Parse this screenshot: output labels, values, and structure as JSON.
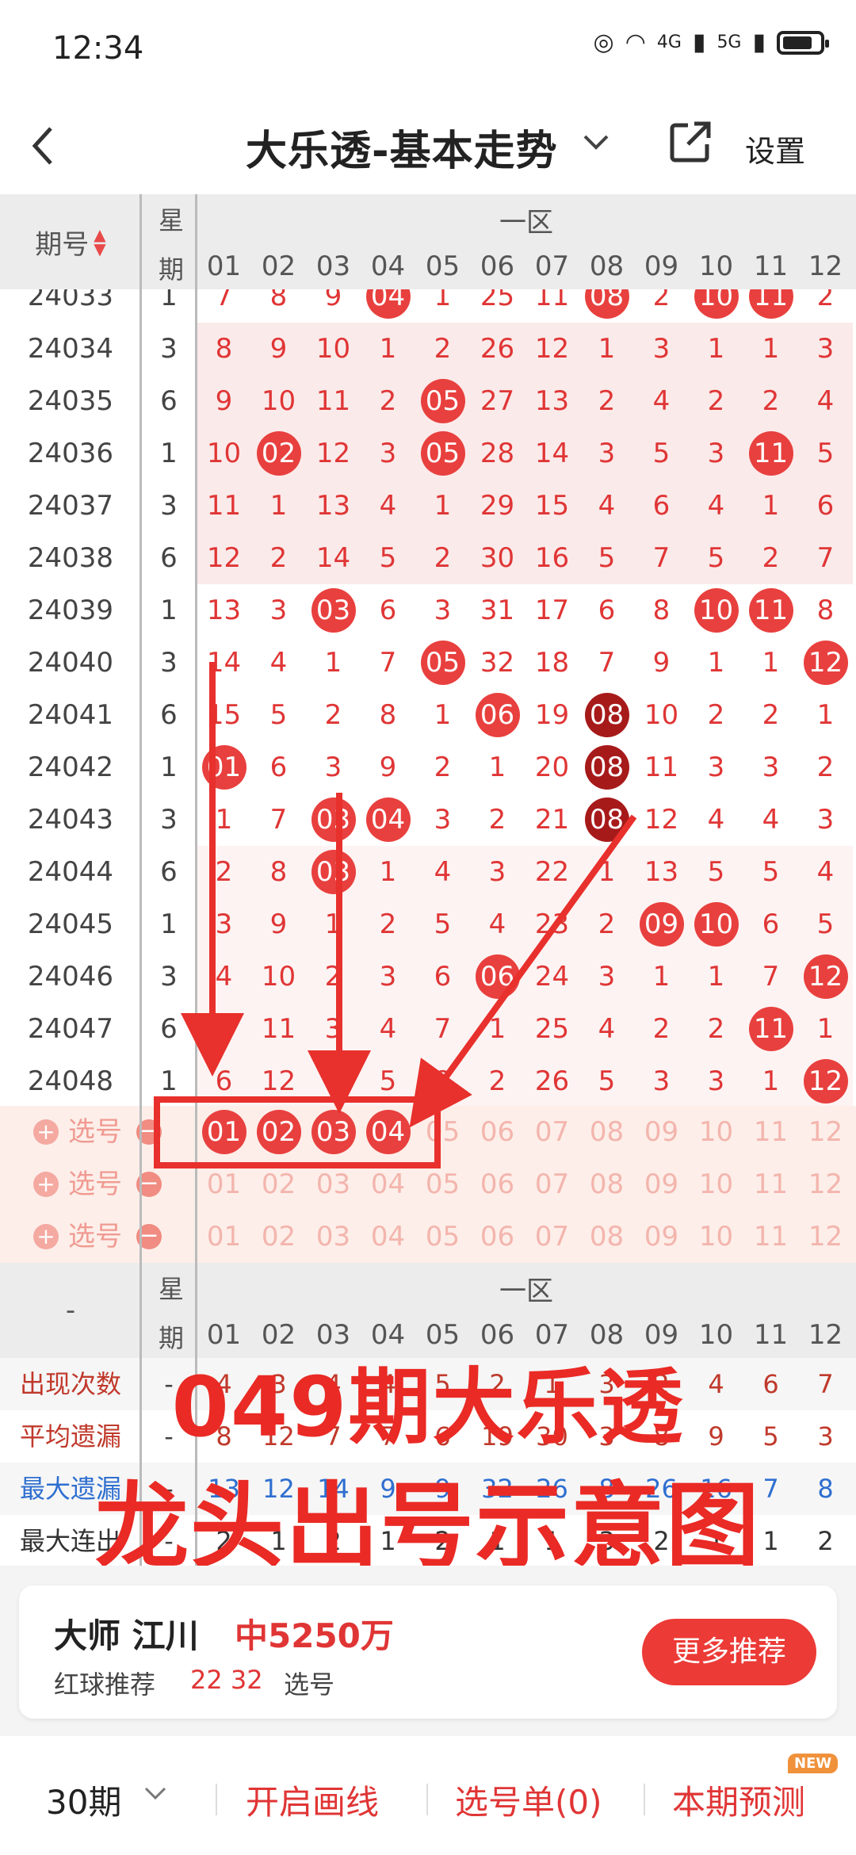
{
  "status": {
    "time": "12:34",
    "net1": "4G",
    "net2": "5G"
  },
  "header": {
    "title": "大乐透-基本走势",
    "settings": "设置"
  },
  "table_header": {
    "issue": "期号",
    "week_top": "星",
    "week_bottom": "期",
    "zone": "一区",
    "cols": [
      "01",
      "02",
      "03",
      "04",
      "05",
      "06",
      "07",
      "08",
      "09",
      "10",
      "11",
      "12"
    ]
  },
  "rows": [
    {
      "issue": "24033",
      "week": "1",
      "cells": [
        "7",
        "8",
        "9",
        "04",
        "1",
        "25",
        "11",
        "08",
        "2",
        "10",
        "11",
        "2"
      ],
      "balls": [
        3,
        7,
        9,
        10
      ]
    },
    {
      "issue": "24034",
      "week": "3",
      "cells": [
        "8",
        "9",
        "10",
        "1",
        "2",
        "26",
        "12",
        "1",
        "3",
        "1",
        "1",
        "3"
      ],
      "balls": []
    },
    {
      "issue": "24035",
      "week": "6",
      "cells": [
        "9",
        "10",
        "11",
        "2",
        "05",
        "27",
        "13",
        "2",
        "4",
        "2",
        "2",
        "4"
      ],
      "balls": [
        4
      ]
    },
    {
      "issue": "24036",
      "week": "1",
      "cells": [
        "10",
        "02",
        "12",
        "3",
        "05",
        "28",
        "14",
        "3",
        "5",
        "3",
        "11",
        "5"
      ],
      "balls": [
        1,
        4,
        10
      ]
    },
    {
      "issue": "24037",
      "week": "3",
      "cells": [
        "11",
        "1",
        "13",
        "4",
        "1",
        "29",
        "15",
        "4",
        "6",
        "4",
        "1",
        "6"
      ],
      "balls": []
    },
    {
      "issue": "24038",
      "week": "6",
      "cells": [
        "12",
        "2",
        "14",
        "5",
        "2",
        "30",
        "16",
        "5",
        "7",
        "5",
        "2",
        "7"
      ],
      "balls": []
    },
    {
      "issue": "24039",
      "week": "1",
      "cells": [
        "13",
        "3",
        "03",
        "6",
        "3",
        "31",
        "17",
        "6",
        "8",
        "10",
        "11",
        "8"
      ],
      "balls": [
        2,
        9,
        10
      ]
    },
    {
      "issue": "24040",
      "week": "3",
      "cells": [
        "14",
        "4",
        "1",
        "7",
        "05",
        "32",
        "18",
        "7",
        "9",
        "1",
        "1",
        "12"
      ],
      "balls": [
        4,
        11
      ]
    },
    {
      "issue": "24041",
      "week": "6",
      "cells": [
        "15",
        "5",
        "2",
        "8",
        "1",
        "06",
        "19",
        "08",
        "10",
        "2",
        "2",
        "1"
      ],
      "balls": [
        5
      ],
      "dark": [
        7
      ]
    },
    {
      "issue": "24042",
      "week": "1",
      "cells": [
        "01",
        "6",
        "3",
        "9",
        "2",
        "1",
        "20",
        "08",
        "11",
        "3",
        "3",
        "2"
      ],
      "balls": [
        0
      ],
      "dark": [
        7
      ]
    },
    {
      "issue": "24043",
      "week": "3",
      "cells": [
        "1",
        "7",
        "03",
        "04",
        "3",
        "2",
        "21",
        "08",
        "12",
        "4",
        "4",
        "3"
      ],
      "balls": [
        2,
        3
      ],
      "dark": [
        7
      ]
    },
    {
      "issue": "24044",
      "week": "6",
      "cells": [
        "2",
        "8",
        "03",
        "1",
        "4",
        "3",
        "22",
        "1",
        "13",
        "5",
        "5",
        "4"
      ],
      "balls": [
        2
      ]
    },
    {
      "issue": "24045",
      "week": "1",
      "cells": [
        "3",
        "9",
        "1",
        "2",
        "5",
        "4",
        "23",
        "2",
        "09",
        "10",
        "6",
        "5"
      ],
      "balls": [
        8,
        9
      ]
    },
    {
      "issue": "24046",
      "week": "3",
      "cells": [
        "4",
        "10",
        "2",
        "3",
        "6",
        "06",
        "24",
        "3",
        "1",
        "1",
        "7",
        "12"
      ],
      "balls": [
        5,
        11
      ]
    },
    {
      "issue": "24047",
      "week": "6",
      "cells": [
        "5",
        "11",
        "3",
        "4",
        "7",
        "1",
        "25",
        "4",
        "2",
        "2",
        "11",
        "1"
      ],
      "balls": [
        10
      ]
    },
    {
      "issue": "24048",
      "week": "1",
      "cells": [
        "6",
        "12",
        "4",
        "5",
        "8",
        "2",
        "26",
        "5",
        "3",
        "3",
        "1",
        "12"
      ],
      "balls": [
        11
      ]
    }
  ],
  "pick_label": "选号",
  "pick_rows": [
    {
      "cells": [
        "01",
        "02",
        "03",
        "04",
        "05",
        "06",
        "07",
        "08",
        "09",
        "10",
        "11",
        "12"
      ],
      "balls": [
        0,
        1,
        2,
        3
      ]
    },
    {
      "cells": [
        "01",
        "02",
        "03",
        "04",
        "05",
        "06",
        "07",
        "08",
        "09",
        "10",
        "11",
        "12"
      ],
      "balls": []
    },
    {
      "cells": [
        "01",
        "02",
        "03",
        "04",
        "05",
        "06",
        "07",
        "08",
        "09",
        "10",
        "11",
        "12"
      ],
      "balls": []
    }
  ],
  "stats_header": {
    "dash": "-",
    "week_top": "星",
    "week_bottom": "期",
    "zone": "一区"
  },
  "stats": [
    {
      "label": "出现次数",
      "color": "#c0392b",
      "wk": "-",
      "cells": [
        "4",
        "3",
        "4",
        "4",
        "5",
        "2",
        "1",
        "3",
        "2",
        "4",
        "6",
        "7"
      ]
    },
    {
      "label": "平均遗漏",
      "color": "#c0392b",
      "wk": "-",
      "cells": [
        "8",
        "12",
        "7",
        "7",
        "6",
        "19",
        "30",
        "3",
        "8",
        "9",
        "5",
        "3"
      ]
    },
    {
      "label": "最大遗漏",
      "color": "#2f6fd0",
      "wk": "-",
      "cells": [
        "13",
        "12",
        "14",
        "9",
        "9",
        "32",
        "26",
        "8",
        "26",
        "16",
        "7",
        "8"
      ]
    },
    {
      "label": "最大连出",
      "color": "#333333",
      "wk": "-",
      "cells": [
        "2",
        "1",
        "2",
        "1",
        "2",
        "1",
        "1",
        "3",
        "2",
        "1",
        "1",
        "2"
      ]
    }
  ],
  "overlay": {
    "line1": "049期大乐透",
    "line2": "龙头出号示意图"
  },
  "card": {
    "master": "大师 江川",
    "prize": "中5250万",
    "rec_label": "红球推荐",
    "rec_nums": "22 32",
    "rec_tail": "选号",
    "more": "更多推荐"
  },
  "bottom": {
    "periods": "30期",
    "draw": "开启画线",
    "list": "选号单(0)",
    "predict": "本期预测",
    "badge": "NEW"
  },
  "colors": {
    "accent": "#e8403e",
    "dark_ball": "#a71a1a"
  }
}
